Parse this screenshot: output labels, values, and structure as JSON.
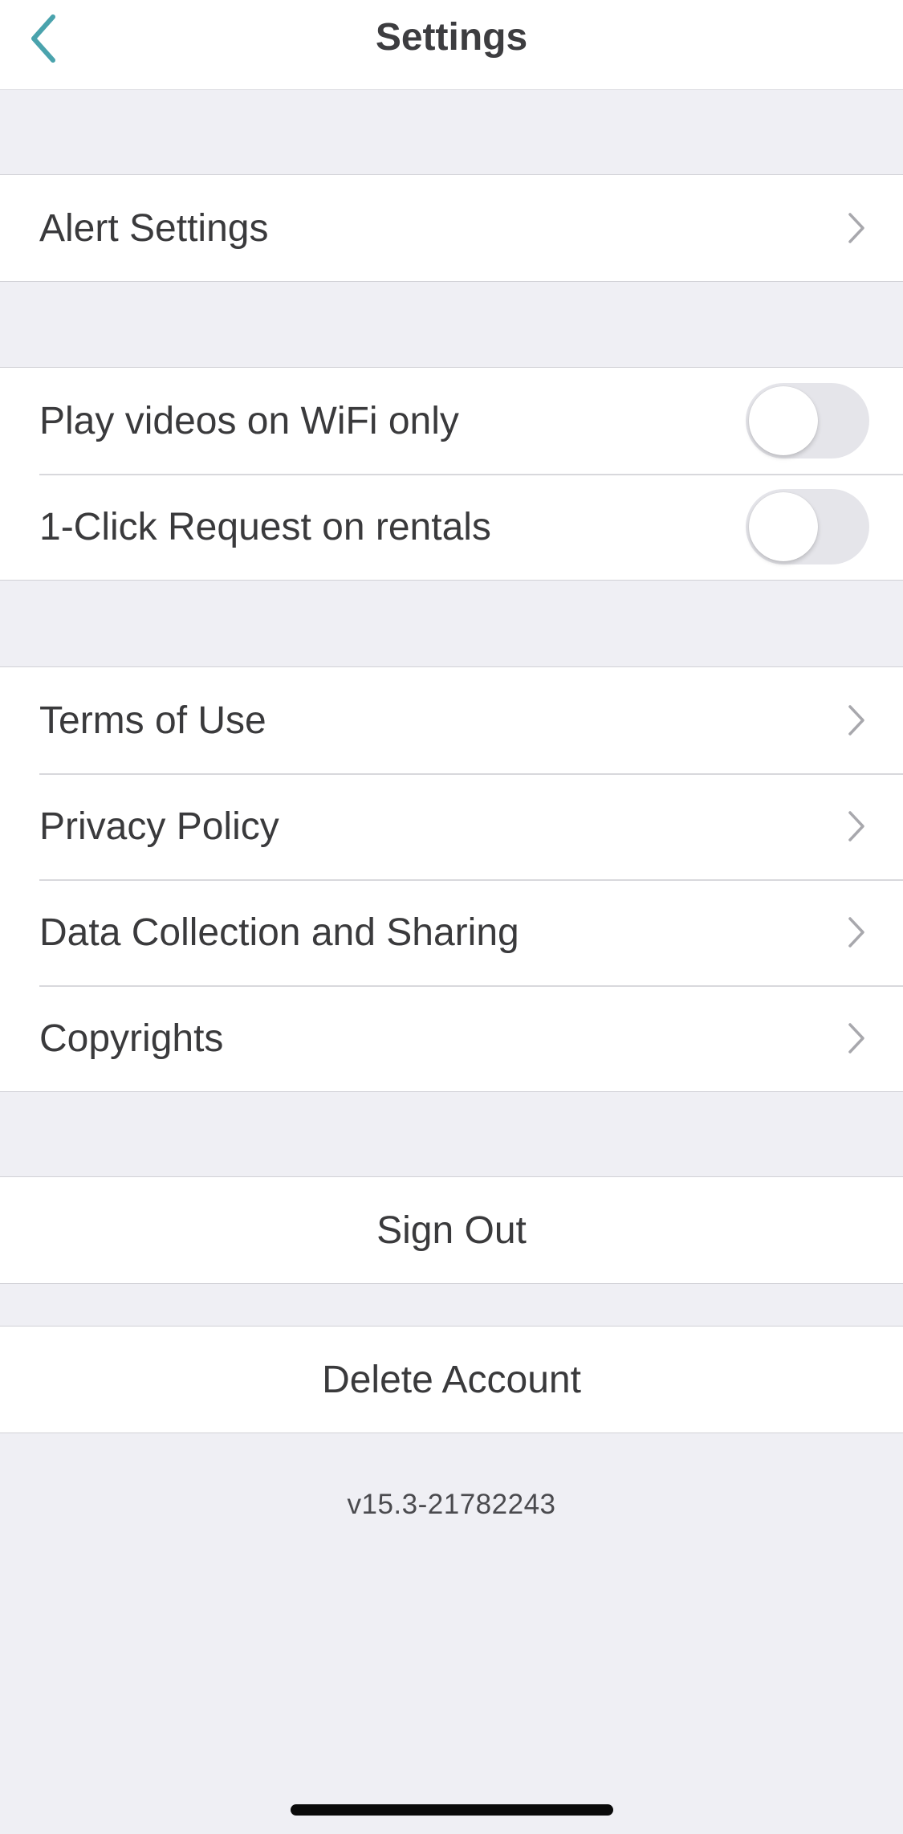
{
  "header": {
    "title": "Settings",
    "back_icon": "chevron-left-icon",
    "accent_color": "#4aa3ad"
  },
  "section_alerts": {
    "items": [
      {
        "label": "Alert Settings"
      }
    ]
  },
  "section_preferences": {
    "items": [
      {
        "label": "Play videos on WiFi only",
        "enabled": false
      },
      {
        "label": "1-Click Request on rentals",
        "enabled": false
      }
    ]
  },
  "section_legal": {
    "items": [
      {
        "label": "Terms of Use"
      },
      {
        "label": "Privacy Policy"
      },
      {
        "label": "Data Collection and Sharing"
      },
      {
        "label": "Copyrights"
      }
    ]
  },
  "actions": {
    "sign_out": "Sign Out",
    "delete_account": "Delete Account"
  },
  "footer": {
    "version": "v15.3-21782243"
  }
}
